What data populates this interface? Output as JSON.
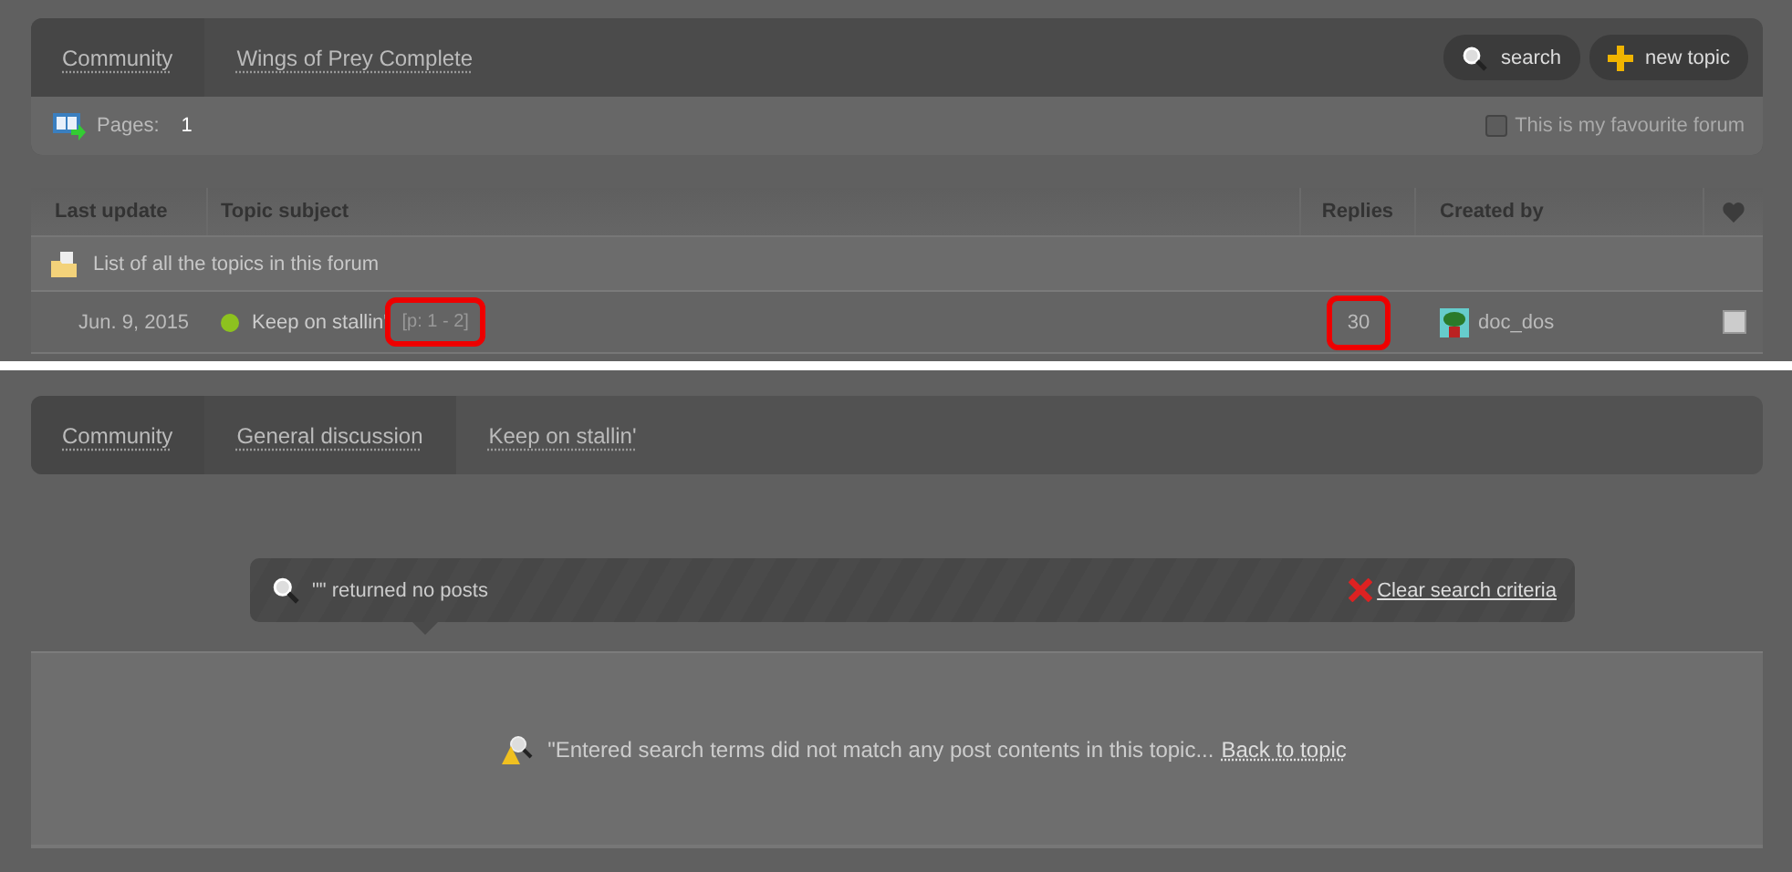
{
  "forum_view": {
    "breadcrumbs": [
      {
        "label": "Community"
      },
      {
        "label": "Wings of Prey Complete"
      }
    ],
    "buttons": [
      {
        "kind": "search",
        "label": "search"
      },
      {
        "kind": "add",
        "label": "new topic"
      }
    ],
    "pages_label": "Pages:",
    "current_page": "1",
    "favourite": {
      "label": "This is my favourite forum",
      "checked": false
    },
    "table": {
      "columns": [
        "Last update",
        "Topic subject",
        "Replies",
        "Created by"
      ],
      "group_row": "List of all the topics in this forum",
      "rows": [
        {
          "last_update": "Jun. 9, 2015",
          "subject": "Keep on stallin'",
          "page_range": "[p: 1 - 2]",
          "page_range_highlighted": true,
          "replies": "30",
          "replies_highlighted": true,
          "created_by": "doc_dos",
          "favourite": false
        }
      ]
    }
  },
  "topic_view": {
    "breadcrumbs": [
      {
        "label": "Community"
      },
      {
        "label": "General discussion"
      },
      {
        "label": "Keep on stallin'"
      }
    ],
    "search_result": "\"\" returned no posts",
    "clear_link": "Clear search criteria",
    "message": "\"Entered search terms did not match any post contents in this topic...",
    "back_link": "Back to topic"
  }
}
